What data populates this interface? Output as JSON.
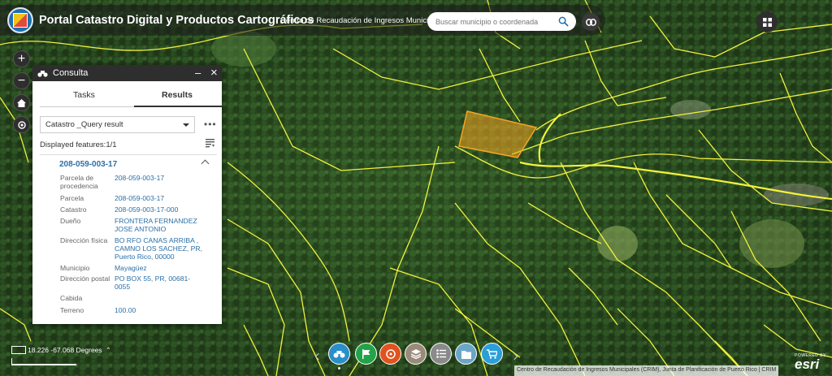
{
  "header": {
    "title": "Portal Catastro Digital y Productos Cartográficos",
    "subtitle": "Centro de Recaudación de Ingresos Municipales",
    "search_placeholder": "Buscar municipio o coordenada"
  },
  "panel": {
    "title": "Consulta",
    "tabs": [
      "Tasks",
      "Results"
    ],
    "active_tab": "Results",
    "layer_select": "Catastro _Query result",
    "displayed_features": "Displayed features:1/1",
    "result_title": "208-059-003-17",
    "fields": [
      {
        "key": "Parcela de procedencia",
        "value": "208-059-003-17"
      },
      {
        "key": "Parcela",
        "value": "208-059-003-17"
      },
      {
        "key": "Catastro",
        "value": "208-059-003-17-000"
      },
      {
        "key": "Dueño",
        "value": "FRONTERA FERNANDEZ JOSE ANTONIO"
      },
      {
        "key": "Dirección física",
        "value": "BO RFO CANAS ARRIBA , CAMNO LOS SACHEZ, PR, Puerto Rico, 00000"
      },
      {
        "key": "Municipio",
        "value": "Mayagüez"
      },
      {
        "key": "Dirección postal",
        "value": "PO BOX 55, PR, 00681-0055"
      },
      {
        "key": "Cabida",
        "value": ""
      },
      {
        "key": "Terreno",
        "value": "100.00"
      }
    ]
  },
  "map": {
    "coordinates": "18.226 -67.068 Degrees",
    "attribution": "Centro de Recaudación de Ingresos Municipales (CRIM), Junta de Planificación de Puerto Rico | CRIM",
    "esri_powered": "POWERED BY",
    "esri_name": "esri",
    "parcel_color": "#f5a623",
    "boundary_color": "#f2f23c"
  },
  "dock": {
    "buttons": [
      {
        "icon": "binoculars-icon",
        "color": "#2a8fc9"
      },
      {
        "icon": "flag-icon",
        "color": "#22a34a"
      },
      {
        "icon": "measure-icon",
        "color": "#e0531f"
      },
      {
        "icon": "layers-icon",
        "color": "#9a8a7a"
      },
      {
        "icon": "legend-icon",
        "color": "#8a8a8a"
      },
      {
        "icon": "print-icon",
        "color": "#6aa6c8"
      },
      {
        "icon": "cart-icon",
        "color": "#2a9fd8"
      }
    ]
  }
}
